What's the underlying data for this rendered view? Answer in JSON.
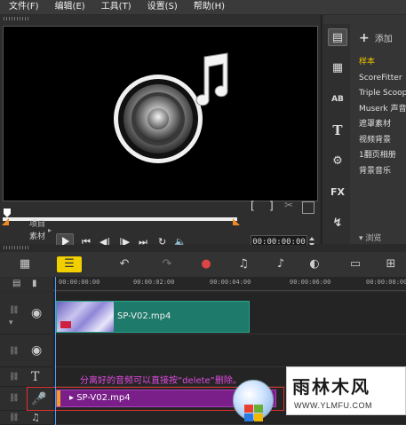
{
  "menubar": {
    "items": [
      "文件(F)",
      "编辑(E)",
      "工具(T)",
      "设置(S)",
      "帮助(H)"
    ]
  },
  "player": {
    "mode_project": "项目",
    "mode_clip": "素材",
    "timecode": "00:00:00:00",
    "scrub_position_pct": 0
  },
  "library": {
    "add_label": "添加",
    "items": [
      "样本",
      "ScoreFitter",
      "Triple Scoop",
      "Muserk 声音",
      "遮罩素材",
      "视频背景",
      "1翻页相册",
      "背景音乐"
    ],
    "selected_index": 0,
    "browse_label": "浏览"
  },
  "timeline": {
    "ruler_ticks": [
      "00:00:00:00",
      "00:00:02:00",
      "00:00:04:00",
      "00:00:06:00",
      "00:00:08:00"
    ],
    "video_clip_name": "SP-V02.mp4",
    "audio_clip_name": "SP-V02.mp4",
    "annotation": "分离好的音频可以直接按“delete”删除。"
  },
  "watermark": {
    "title": "雨林木风",
    "url": "WWW.YLMFU.COM"
  },
  "colors": {
    "accent_yellow": "#f2d000",
    "video_clip": "#1e7a6a",
    "audio_clip": "#7a1f8a",
    "annotation": "#e34be3",
    "highlight_box": "#e03030"
  }
}
